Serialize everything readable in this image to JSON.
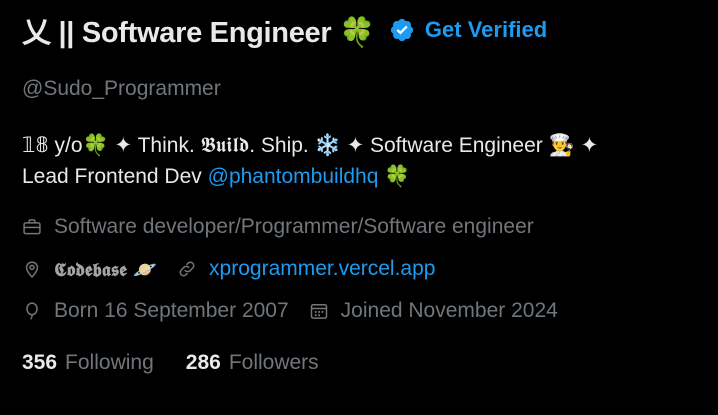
{
  "profile": {
    "display_name": "乂 || Software Engineer 🍀",
    "verify_cta": "Get Verified",
    "handle": "@Sudo_Programmer",
    "bio_line1": "𝟙𝟠 y/o🍀 ✦ Think. 𝕭𝖚𝖎𝖑𝖉. Ship. ❄️ ✦ Software Engineer 👨‍🍳 ✦",
    "bio_line2_prefix": "Lead Frontend Dev ",
    "bio_mention": "@phantombuildhq",
    "bio_line2_suffix": " 🍀",
    "category": "Software developer/Programmer/Software engineer",
    "location": "𝕮𝖔𝖉𝖊𝖇𝖆𝖘𝖊 🪐",
    "website": "xprogrammer.vercel.app",
    "birthday": "Born 16 September 2007",
    "joined": "Joined November 2024",
    "following_count": "356",
    "following_label": "Following",
    "followers_count": "286",
    "followers_label": "Followers"
  },
  "icons": {
    "verified": "verified-badge-icon",
    "category": "briefcase-icon",
    "location": "location-pin-icon",
    "website": "link-icon",
    "birthday": "balloon-icon",
    "joined": "calendar-icon"
  },
  "colors": {
    "background": "#000000",
    "primary_text": "#e7e9ea",
    "secondary_text": "#71767b",
    "accent": "#1d9bf0"
  }
}
